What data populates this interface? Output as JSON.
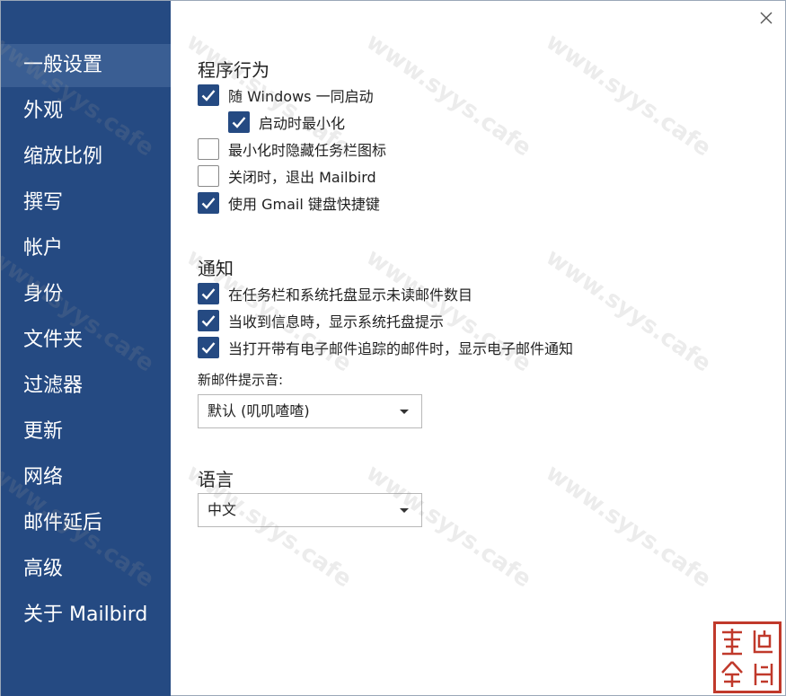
{
  "sidebar": {
    "items": [
      {
        "label": "一般设置",
        "active": true
      },
      {
        "label": "外观",
        "active": false
      },
      {
        "label": "缩放比例",
        "active": false
      },
      {
        "label": "撰写",
        "active": false
      },
      {
        "label": "帐户",
        "active": false
      },
      {
        "label": "身份",
        "active": false
      },
      {
        "label": "文件夹",
        "active": false
      },
      {
        "label": "过滤器",
        "active": false
      },
      {
        "label": "更新",
        "active": false
      },
      {
        "label": "网络",
        "active": false
      },
      {
        "label": "邮件延后",
        "active": false
      },
      {
        "label": "高级",
        "active": false
      },
      {
        "label": "关于 Mailbird",
        "active": false
      }
    ]
  },
  "program_behavior": {
    "title": "程序行为",
    "options": [
      {
        "label": "随 Windows 一同启动",
        "checked": true
      },
      {
        "label": "启动时最小化",
        "checked": true
      },
      {
        "label": "最小化时隐藏任务栏图标",
        "checked": false
      },
      {
        "label": "关闭时，退出 Mailbird",
        "checked": false
      },
      {
        "label": "使用 Gmail 键盘快捷键",
        "checked": true
      }
    ]
  },
  "notifications": {
    "title": "通知",
    "options": [
      {
        "label": "在任务栏和系统托盘显示未读邮件数目",
        "checked": true
      },
      {
        "label": "当收到信息時，显示系统托盘提示",
        "checked": true
      },
      {
        "label": "当打开带有电子邮件追踪的邮件时，显示电子邮件通知",
        "checked": true
      }
    ],
    "sound_label": "新邮件提示音:",
    "sound_value": "默认 (叽叽喳喳)"
  },
  "language": {
    "title": "语言",
    "value": "中文"
  },
  "watermark_text": "www.syys.cafe",
  "colors": {
    "sidebar_bg": "#254a82",
    "sidebar_active": "#3a5e93",
    "checkbox_on": "#254a82",
    "seal_red": "#c0392b"
  },
  "icons": {
    "close": "close-icon",
    "checkmark": "checkmark-icon",
    "dropdown": "chevron-down-icon",
    "seal": "seal-stamp"
  }
}
